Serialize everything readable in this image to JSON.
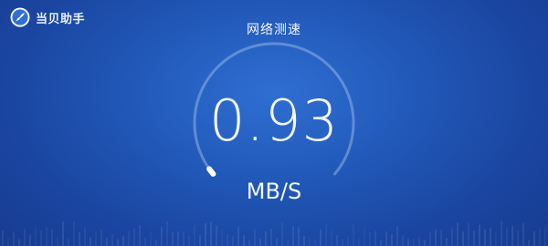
{
  "app": {
    "name": "当贝助手",
    "logo_icon": "rocket-icon"
  },
  "page": {
    "title": "网络测速"
  },
  "speed": {
    "value": "0.93",
    "unit": "MB/S",
    "gauge_level_fraction": 0.01
  },
  "colors": {
    "background": "#2158b8",
    "gauge_track": "#8fb0e6",
    "gauge_fill": "#ffffff",
    "text": "#f4f8ff"
  }
}
